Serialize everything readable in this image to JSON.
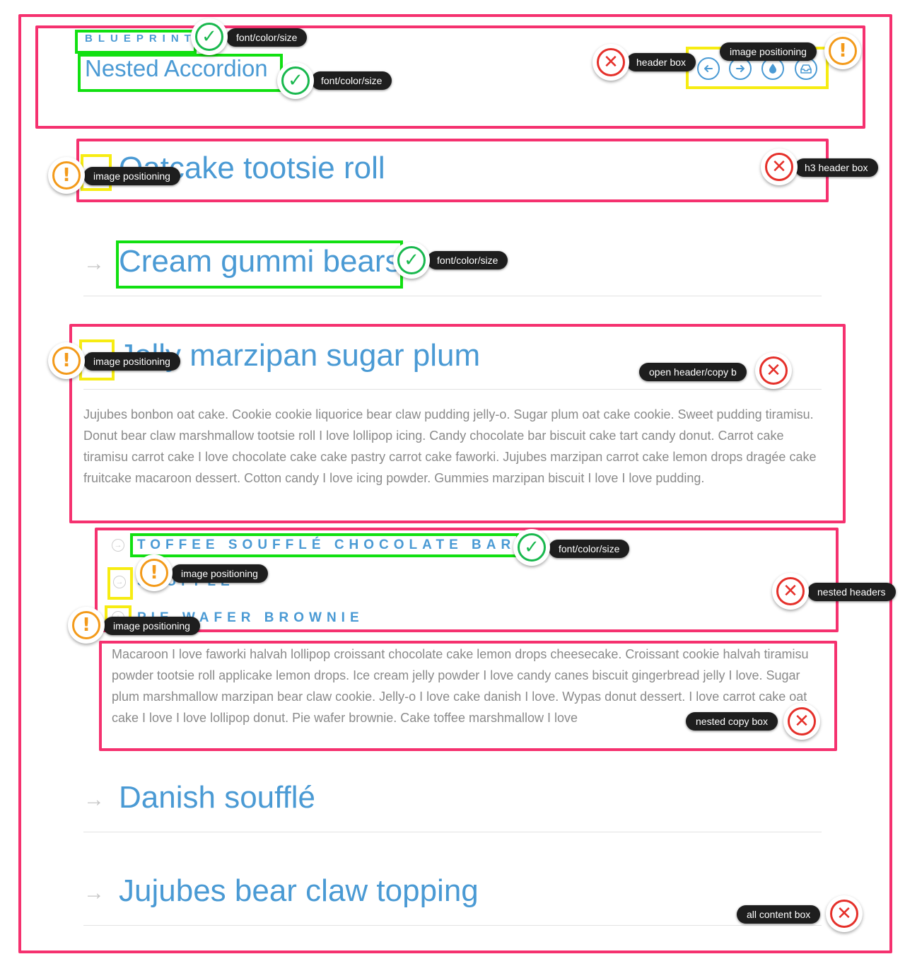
{
  "header": {
    "eyebrow": "BLUEPRINT",
    "title": "Nested Accordion",
    "icons": [
      "arrow-left-icon",
      "arrow-right-icon",
      "droplet-icon",
      "inbox-icon"
    ]
  },
  "accordion": {
    "items": [
      {
        "title": "Oatcake tootsie roll",
        "state": "collapsed"
      },
      {
        "title": "Cream gummi bears",
        "state": "collapsed"
      },
      {
        "title": "Jelly marzipan sugar plum",
        "state": "expanded",
        "copy": "Jujubes bonbon oat cake. Cookie cookie liquorice bear claw pudding jelly-o. Sugar plum oat cake cookie. Sweet pudding tiramisu. Donut bear claw marshmallow tootsie roll I love lollipop icing. Candy chocolate bar biscuit cake tart candy donut. Carrot cake tiramisu carrot cake I love chocolate cake cake pastry carrot cake faworki. Jujubes marzipan carrot cake lemon drops dragée cake fruitcake macaroon dessert. Cotton candy I love icing powder. Gummies marzipan biscuit I love I love pudding."
      },
      {
        "title": "Danish soufflé",
        "state": "collapsed"
      },
      {
        "title": "Jujubes bear claw topping",
        "state": "collapsed"
      }
    ],
    "nested": {
      "items": [
        {
          "title": "TOFFEE SOUFFLÉ CHOCOLATE BAR",
          "state": "collapsed"
        },
        {
          "title": "SOUFFLÉ",
          "state": "collapsed"
        },
        {
          "title": "PIE WAFER BROWNIE",
          "state": "expanded"
        }
      ],
      "copy": "Macaroon I love faworki halvah lollipop croissant chocolate cake lemon drops cheesecake. Croissant cookie halvah tiramisu powder tootsie roll applicake lemon drops. Ice cream jelly powder I love candy canes biscuit gingerbread jelly I love. Sugar plum marshmallow marzipan bear claw cookie. Jelly-o I love cake danish I love. Wypas donut dessert. I love carrot cake oat cake I love I love lollipop donut. Pie wafer brownie. Cake toffee marshmallow I love"
    }
  },
  "review": {
    "labels": {
      "eyebrow": "font/color/size",
      "title": "font/color/size",
      "header_box": "header box",
      "header_icons": "image positioning",
      "item1_icon": "image positioning",
      "h3_header_box": "h3 header box",
      "item2_title": "font/color/size",
      "item3_icon": "image positioning",
      "open_header": "open header/copy b",
      "nested1_title": "font/color/size",
      "nested2_icon": "image positioning",
      "nested_headers": "nested headers",
      "nested3_icon": "image positioning",
      "nested_copy_box": "nested copy box",
      "all_content_box": "all content box"
    },
    "colors": {
      "error": "#e5302a",
      "warning": "#f39a1a",
      "success": "#19b84e",
      "box_pink": "#f5316f",
      "box_green": "#11e011",
      "box_yellow": "#f7ec12",
      "link_blue": "#4a9ad4"
    }
  }
}
